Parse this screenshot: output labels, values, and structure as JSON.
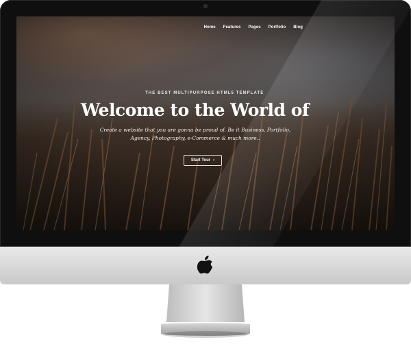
{
  "nav": {
    "items": [
      "Home",
      "Features",
      "Pages",
      "Portfolio",
      "Blog"
    ]
  },
  "hero": {
    "eyebrow": "THE BEST MULTIPURPOSE HTML5 TEMPLATE",
    "headline": "Welcome to the World of",
    "subtitle_line1": "Create a website that you are gonna be proud of. Be it Business, Portfolio,",
    "subtitle_line2": "Agency, Photography, e-Commerce & much more..",
    "cta_label": "Start Tour",
    "cta_icon": "chevron-right-icon"
  },
  "device": {
    "logo": "apple-logo"
  },
  "colors": {
    "bezel": "#0f0f10",
    "text": "#ffffff",
    "chin": "#d8d8d9"
  }
}
